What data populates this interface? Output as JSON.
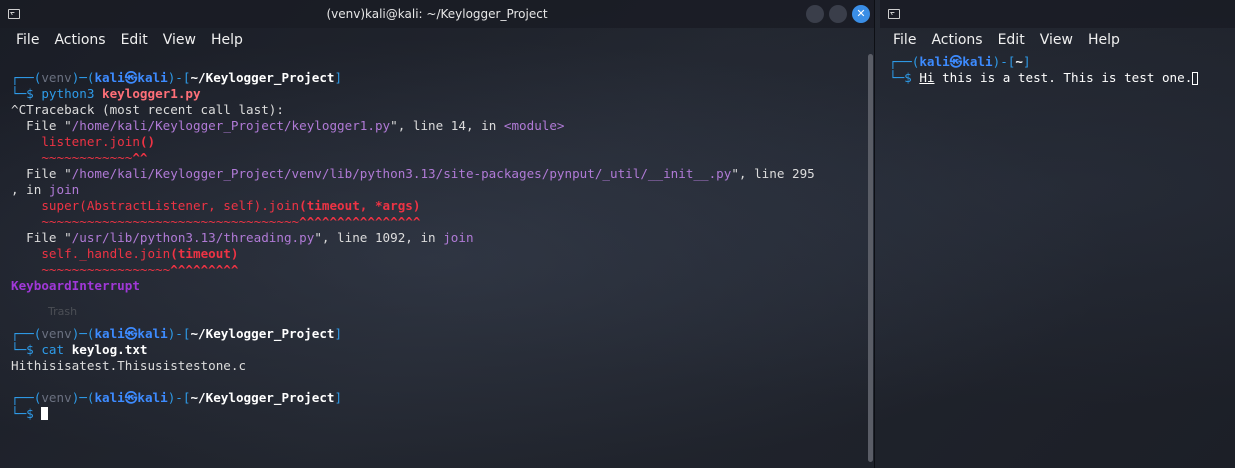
{
  "left_window": {
    "title": "(venv)kali@kali: ~/Keylogger_Project",
    "menu": [
      "File",
      "Actions",
      "Edit",
      "View",
      "Help"
    ],
    "ghost_label": "Trash",
    "prompt1": {
      "top_open": "┌──(",
      "venv": "venv",
      "sep": ")─(",
      "user": "kali㉿kali",
      "mid": ")-[",
      "path": "~/Keylogger_Project",
      "close": "]",
      "bottom": "└─$ ",
      "cmd": "python3",
      "arg": "keylogger1.py"
    },
    "traceback": {
      "l1": "^CTraceback (most recent call last):",
      "f1_a": "  File \"",
      "f1_path": "/home/kali/Keylogger_Project/keylogger1.py",
      "f1_b": "\", line 14, in ",
      "f1_fn": "<module>",
      "f1_code_a": "    listener.join",
      "f1_code_b": "()",
      "f1_tilde": "    ~~~~~~~~~~~~",
      "f1_caret": "^^",
      "f2_a": "  File \"",
      "f2_path": "/home/kali/Keylogger_Project/venv/lib/python3.13/site-packages/pynput/_util/__init__.py",
      "f2_b": "\", line 295",
      "f2_c": ", in ",
      "f2_fn": "join",
      "f2_code_a": "    super(AbstractListener, self).join",
      "f2_code_b": "(timeout, *args)",
      "f2_tilde": "    ~~~~~~~~~~~~~~~~~~~~~~~~~~~~~~~~~~",
      "f2_caret": "^^^^^^^^^^^^^^^^",
      "f3_a": "  File \"",
      "f3_path": "/usr/lib/python3.13/threading.py",
      "f3_b": "\", line 1092, in ",
      "f3_fn": "join",
      "f3_code_a": "    self._handle.join",
      "f3_code_b": "(timeout)",
      "f3_tilde": "    ~~~~~~~~~~~~~~~~~",
      "f3_caret": "^^^^^^^^^",
      "error": "KeyboardInterrupt"
    },
    "prompt2": {
      "top_open": "┌──(",
      "venv": "venv",
      "sep": ")─(",
      "user": "kali㉿kali",
      "mid": ")-[",
      "path": "~/Keylogger_Project",
      "close": "]",
      "bottom": "└─$ ",
      "cmd": "cat",
      "arg": "keylog.txt"
    },
    "output": "Hithisisatest.Thisusistestone.c",
    "prompt3": {
      "top_open": "┌──(",
      "venv": "venv",
      "sep": ")─(",
      "user": "kali㉿kali",
      "mid": ")-[",
      "path": "~/Keylogger_Project",
      "close": "]",
      "bottom": "└─$ "
    }
  },
  "right_window": {
    "menu": [
      "File",
      "Actions",
      "Edit",
      "View",
      "Help"
    ],
    "prompt": {
      "top_open": "┌──(",
      "user": "kali㉿kali",
      "mid": ")-[",
      "path": "~",
      "close": "]",
      "bottom": "└─$ ",
      "typed_first": "Hi",
      "typed_rest": " this is a test. This is test one."
    }
  },
  "window_controls": [
    "minimize",
    "maximize",
    "close"
  ]
}
